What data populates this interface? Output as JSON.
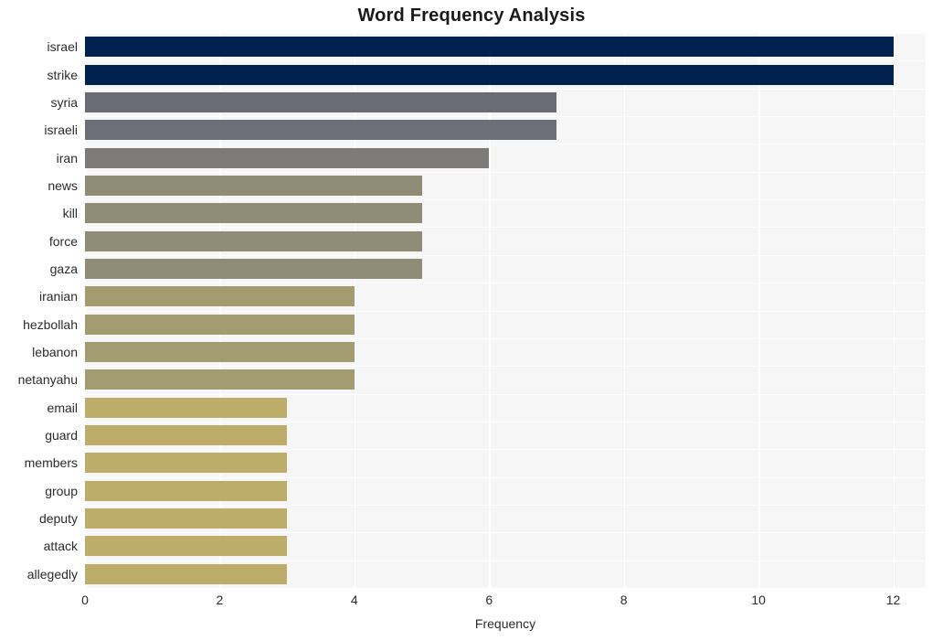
{
  "chart_data": {
    "type": "bar",
    "orientation": "horizontal",
    "title": "Word Frequency Analysis",
    "xlabel": "Frequency",
    "ylabel": "",
    "categories": [
      "israel",
      "strike",
      "syria",
      "israeli",
      "iran",
      "news",
      "kill",
      "force",
      "gaza",
      "iranian",
      "hezbollah",
      "lebanon",
      "netanyahu",
      "email",
      "guard",
      "members",
      "group",
      "deputy",
      "attack",
      "allegedly"
    ],
    "values": [
      12,
      12,
      7,
      7,
      6,
      5,
      5,
      5,
      5,
      4,
      4,
      4,
      4,
      3,
      3,
      3,
      3,
      3,
      3,
      3
    ],
    "bar_colors": [
      "#00224e",
      "#00224e",
      "#6a6c75",
      "#6d6e77",
      "#7c7b78",
      "#918c78",
      "#918c78",
      "#918c78",
      "#918c78",
      "#a39c70",
      "#a39c70",
      "#a39c70",
      "#a39c70",
      "#bdad6a",
      "#bdad6a",
      "#bdad6a",
      "#bdad6a",
      "#bdad6a",
      "#bdad6a",
      "#bdad6a"
    ],
    "xlim": [
      0,
      12.5
    ],
    "xticks": [
      0,
      2,
      4,
      6,
      8,
      10,
      12
    ],
    "xtick_labels": [
      "0",
      "2",
      "4",
      "6",
      "8",
      "10",
      "12"
    ],
    "grid": true,
    "grid_color": "#ffffff",
    "plot_background": "#f6f6f6",
    "figure_background": "#ffffff",
    "legend": null,
    "colormap": "cividis"
  }
}
